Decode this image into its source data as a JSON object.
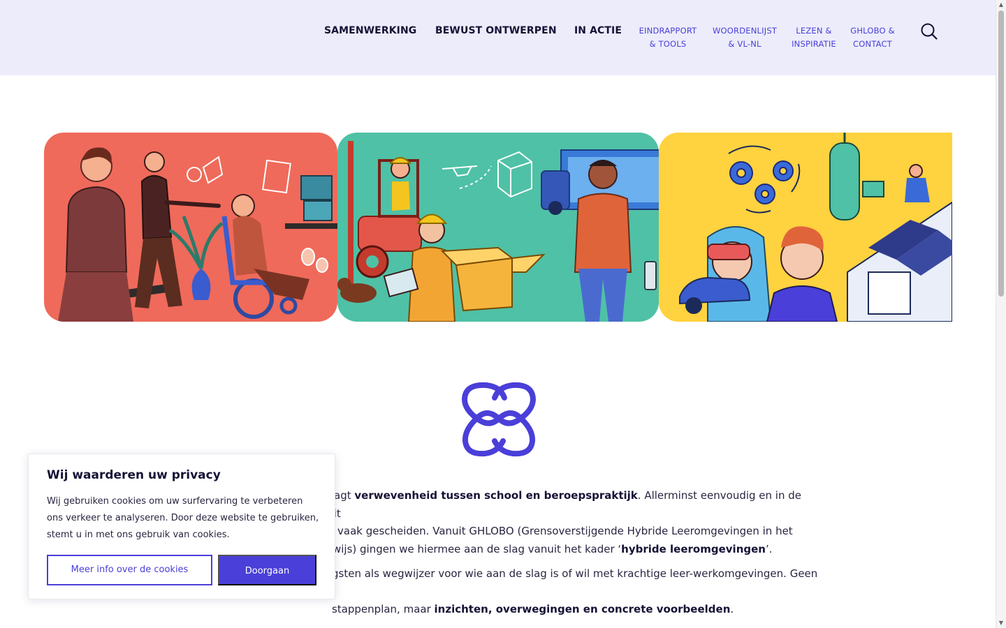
{
  "header": {
    "main_nav": [
      {
        "label": "SAMENWERKING"
      },
      {
        "label": "BEWUST ONTWERPEN"
      },
      {
        "label": "IN ACTIE"
      }
    ],
    "sub_nav": [
      {
        "line1": "EINDRAPPORT",
        "line2": "& TOOLS"
      },
      {
        "line1": "WOORDENLIJST",
        "line2": "& VL-NL"
      },
      {
        "line1": "LEZEN &",
        "line2": "INSPIRATIE"
      },
      {
        "line1": "GHLOBO &",
        "line2": "CONTACT"
      }
    ],
    "search_icon": "search-icon"
  },
  "hero": {
    "panels": [
      {
        "color": "#ef6a5a",
        "theme": "zorg"
      },
      {
        "color": "#4fc1a6",
        "theme": "logistiek"
      },
      {
        "color": "#ffd23f",
        "theme": "techniek"
      }
    ]
  },
  "logo": {
    "icon": "interlinked-chain-icon",
    "color": "#4a3fd8"
  },
  "intro": {
    "p1": {
      "t1": "agt ",
      "b1": "verwevenheid tussen school en beroepspraktijk",
      "t2": ". Allerminst eenvoudig en in de realiteit",
      "t3": "vaak gescheiden. Vanuit GHLOBO (Grensoverstijgende Hybride Leeromgevingen in het",
      "t4": "wijs) gingen we hiermee aan de slag vanuit het kader ‘",
      "b2": "hybride leeromgevingen",
      "t5": "’."
    },
    "p2": {
      "t1": "gsten als wegwijzer voor wie aan de slag is of wil met krachtige leer-werkomgevingen. Geen te",
      "t2": "stappenplan, maar ",
      "b1": "inzichten, overwegingen en concrete voorbeelden",
      "t3": "."
    }
  },
  "cookie": {
    "title": "Wij waarderen uw privacy",
    "text": "Wij gebruiken cookies om uw surfervaring te verbeteren ons verkeer te analyseren. Door deze website te gebruiken, stemt u in met ons gebruik van cookies.",
    "more_label": "Meer info over de cookies",
    "accept_label": "Doorgaan"
  },
  "colors": {
    "accent": "#4a3fd8",
    "header_bg": "#ececfb",
    "text_dark": "#141235"
  }
}
